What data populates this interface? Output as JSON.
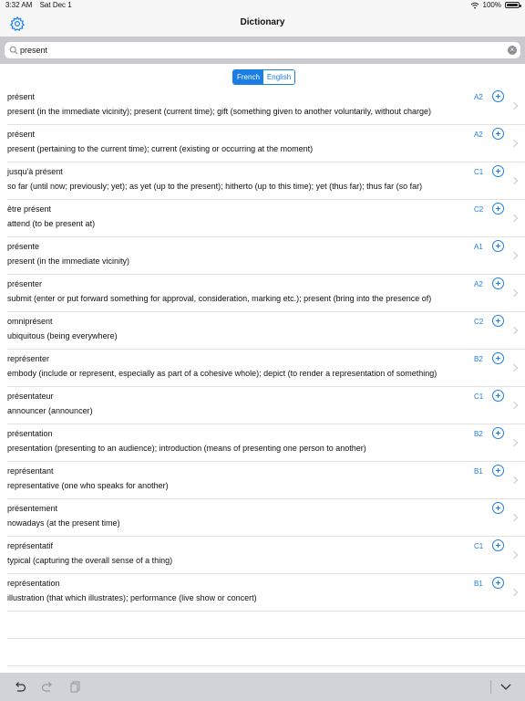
{
  "status_bar": {
    "time": "3:32 AM",
    "date": "Sat Dec 1",
    "battery": "100%"
  },
  "nav": {
    "title": "Dictionary",
    "settings_icon": "gear-icon"
  },
  "search": {
    "value": "present",
    "placeholder": ""
  },
  "language_toggle": {
    "options": [
      "French",
      "English"
    ],
    "selected": "French"
  },
  "entries": [
    {
      "word": "présent",
      "definition": "present (in the immediate vicinity); present (current time); gift (something given to another voluntarily, without charge)",
      "level": "A2"
    },
    {
      "word": "présent",
      "definition": "present (pertaining to the current time); current (existing or occurring at the moment)",
      "level": "A2"
    },
    {
      "word": "jusqu'à présent",
      "definition": "so far (until now; previously; yet); as yet (up to the present); hitherto (up to this time); yet (thus far); thus far (so far)",
      "level": "C1"
    },
    {
      "word": "être présent",
      "definition": "attend (to be present at)",
      "level": "C2"
    },
    {
      "word": "présente",
      "definition": "present (in the immediate vicinity)",
      "level": "A1"
    },
    {
      "word": "présenter",
      "definition": "submit (enter or put forward something for approval, consideration, marking etc.); present (bring into the presence of)",
      "level": "A2"
    },
    {
      "word": "omniprésent",
      "definition": "ubiquitous (being everywhere)",
      "level": "C2"
    },
    {
      "word": "représenter",
      "definition": "embody (include or represent, especially as part of a cohesive whole); depict (to render a representation of something)",
      "level": "B2"
    },
    {
      "word": "présentateur",
      "definition": "announcer (announcer)",
      "level": "C1"
    },
    {
      "word": "présentation",
      "definition": "presentation (presenting to an audience); introduction (means of presenting one person to another)",
      "level": "B2"
    },
    {
      "word": "représentant",
      "definition": "representative (one who speaks for another)",
      "level": "B1"
    },
    {
      "word": "présentement",
      "definition": "nowadays (at the present time)",
      "level": ""
    },
    {
      "word": "représentatif",
      "definition": "typical (capturing the overall sense of a thing)",
      "level": "C1"
    },
    {
      "word": "représentation",
      "definition": "illustration (that which illustrates); performance (live show or concert)",
      "level": "B1"
    }
  ],
  "colors": {
    "accent": "#1a7ee6",
    "toolbar": "#d1d3d9",
    "search_bar": "#c9c9ce"
  }
}
